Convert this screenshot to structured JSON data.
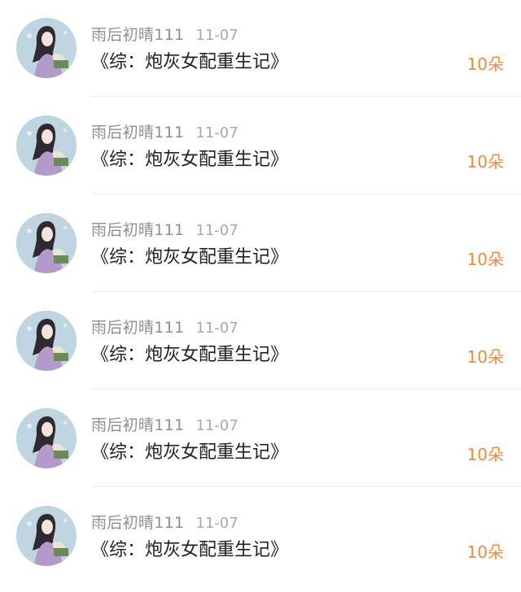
{
  "gift_list": {
    "items": [
      {
        "username": "雨后初晴111",
        "date": "11-07",
        "book_title": "《综：炮灰女配重生记》",
        "amount": "10朵"
      },
      {
        "username": "雨后初晴111",
        "date": "11-07",
        "book_title": "《综：炮灰女配重生记》",
        "amount": "10朵"
      },
      {
        "username": "雨后初晴111",
        "date": "11-07",
        "book_title": "《综：炮灰女配重生记》",
        "amount": "10朵"
      },
      {
        "username": "雨后初晴111",
        "date": "11-07",
        "book_title": "《综：炮灰女配重生记》",
        "amount": "10朵"
      },
      {
        "username": "雨后初晴111",
        "date": "11-07",
        "book_title": "《综：炮灰女配重生记》",
        "amount": "10朵"
      },
      {
        "username": "雨后初晴111",
        "date": "11-07",
        "book_title": "《综：炮灰女配重生记》",
        "amount": "10朵"
      }
    ]
  },
  "colors": {
    "amount": "#f08a3c",
    "username": "#8e8e8e",
    "date": "#a8a8a8",
    "title": "#222222"
  },
  "icons": {
    "avatar": "avatar-portrait-icon"
  }
}
